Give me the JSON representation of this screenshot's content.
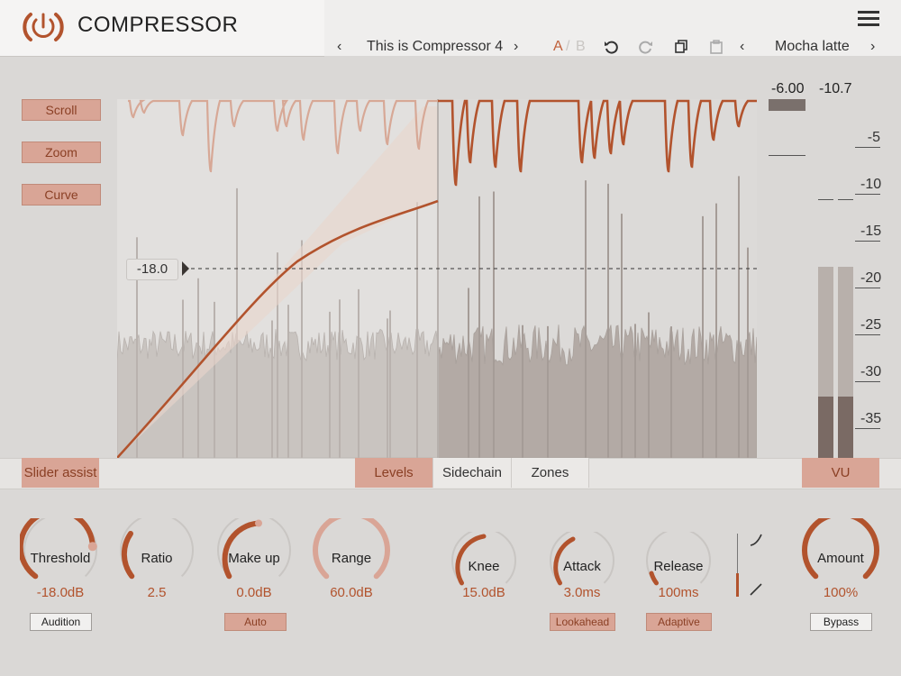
{
  "app": {
    "title": "COMPRESSOR"
  },
  "toolbar": {
    "preset_name": "This is Compressor 4",
    "ab_a": "A",
    "ab_sep": "/",
    "ab_b": "B",
    "skin_name": "Mocha latte"
  },
  "side_buttons": {
    "scroll": "Scroll",
    "zoom": "Zoom",
    "curve": "Curve"
  },
  "graph": {
    "threshold_marker": "-18.0"
  },
  "meter": {
    "readout_left": "-6.00",
    "readout_right": "-10.7",
    "scale": [
      "-5",
      "-10",
      "-15",
      "-20",
      "-25",
      "-30",
      "-35"
    ]
  },
  "tabs": {
    "slider_assist": "Slider assist",
    "levels": "Levels",
    "sidechain": "Sidechain",
    "zones": "Zones",
    "vu": "VU"
  },
  "controls": {
    "threshold": {
      "label": "Threshold",
      "value": "-18.0dB",
      "button": "Audition"
    },
    "ratio": {
      "label": "Ratio",
      "value": "2.5"
    },
    "makeup": {
      "label": "Make up",
      "value": "0.0dB",
      "button": "Auto"
    },
    "range": {
      "label": "Range",
      "value": "60.0dB"
    },
    "knee": {
      "label": "Knee",
      "value": "15.0dB"
    },
    "attack": {
      "label": "Attack",
      "value": "3.0ms",
      "button": "Lookahead"
    },
    "release": {
      "label": "Release",
      "value": "100ms",
      "button": "Adaptive"
    },
    "amount": {
      "label": "Amount",
      "value": "100%",
      "button": "Bypass"
    }
  },
  "colors": {
    "accent": "#b2532d",
    "accent_light": "#d9a596",
    "background": "#dad8d6"
  }
}
